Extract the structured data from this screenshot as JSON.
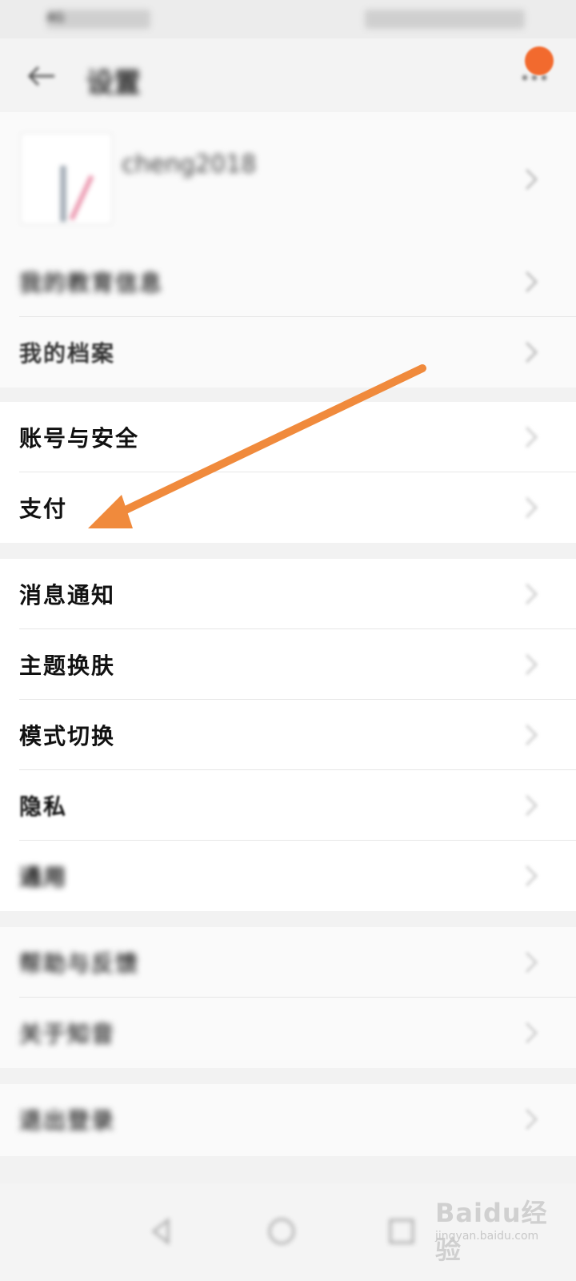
{
  "status_bar": {
    "left": "4G",
    "right": ""
  },
  "header": {
    "title": "设置"
  },
  "profile": {
    "username": "cheng2018",
    "id": ""
  },
  "sections": [
    {
      "rows": [
        {
          "label": "我的教育信息",
          "value": ""
        },
        {
          "label": "我的档案",
          "value": ""
        }
      ]
    },
    {
      "rows": [
        {
          "label": "账号与安全",
          "value": ""
        },
        {
          "label": "支付",
          "value": ""
        }
      ]
    },
    {
      "rows": [
        {
          "label": "消息通知",
          "value": ""
        },
        {
          "label": "主题换肤",
          "value": ""
        },
        {
          "label": "模式切换",
          "value": ""
        },
        {
          "label": "隐私",
          "value": ""
        },
        {
          "label": "通用",
          "value": ""
        }
      ]
    },
    {
      "rows": [
        {
          "label": "帮助与反馈",
          "value": ""
        },
        {
          "label": "关于知音",
          "value": ""
        }
      ]
    },
    {
      "rows": [
        {
          "label": "退出登录",
          "value": ""
        }
      ]
    }
  ],
  "annotation": {
    "color": "#f08a3c",
    "icon": "arrow-pointer-icon"
  },
  "watermark": {
    "logo": "Baidu经验",
    "url": "jingyan.baidu.com"
  },
  "colors": {
    "accent": "#f26a2e",
    "background": "#f2f2f2"
  }
}
